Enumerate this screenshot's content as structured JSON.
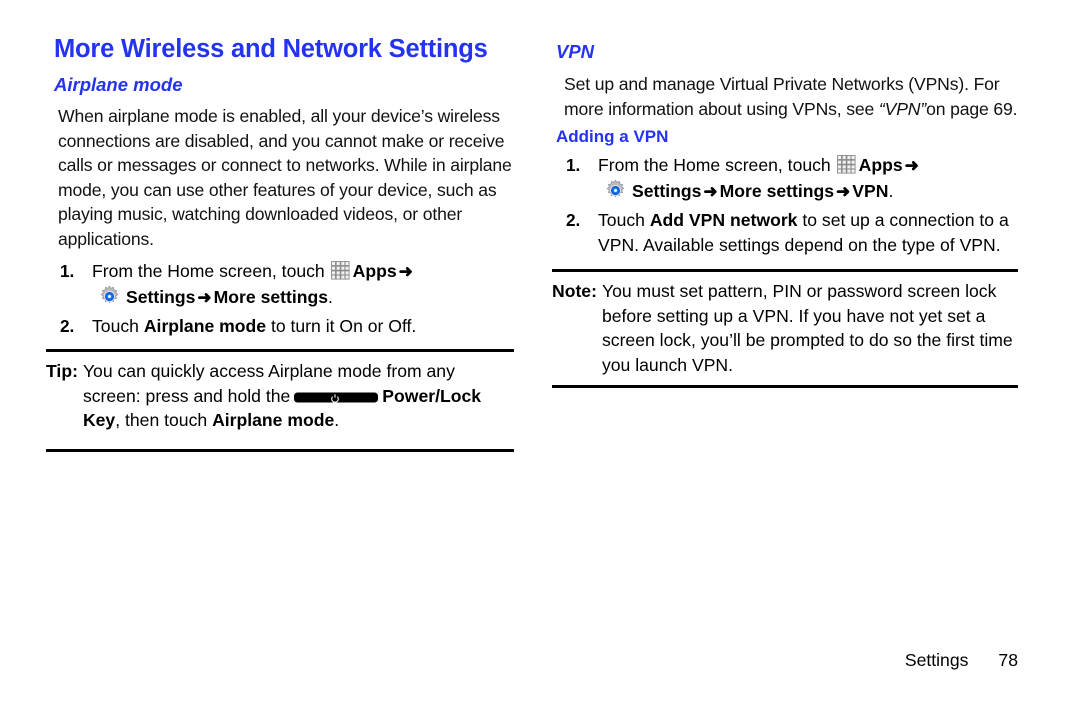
{
  "page": {
    "title": "More Wireless and Network Settings",
    "accent_color": "#2433f0",
    "text_color": "#111111"
  },
  "left_column": {
    "section_heading": "Airplane mode",
    "intro_paragraph": "When airplane mode is enabled, all your device’s wireless connections are disabled, and you cannot make or receive calls or messages or connect to networks. While in airplane mode, you can use other features of your device, such as playing music, watching downloaded videos, or other applications.",
    "steps": [
      {
        "number": "1.",
        "lead": "From the Home screen, touch",
        "apps_label": "Apps",
        "arrow1": "➜",
        "settings_label": "Settings",
        "arrow2": "➜",
        "more_settings_label": "More settings",
        "period": "."
      },
      {
        "number": "2.",
        "text_before": "Touch",
        "bold_term": "Airplane mode",
        "text_after": "to turn it On or Off."
      }
    ],
    "tip": {
      "label": "Tip:",
      "line1": "You can quickly access Airplane mode from any screen:",
      "line2_before": "press and hold the",
      "power_key_label": "Power/Lock Key",
      "line2_after": ", then touch",
      "line3_bold": "Airplane mode",
      "line3_period": "."
    }
  },
  "right_column": {
    "section_heading": "VPN",
    "intro_before": "Set up and manage Virtual Private Networks (VPNs). For more information about using VPNs, see",
    "intro_quoted_italic": "“VPN”",
    "intro_after": "on page 69.",
    "sub_heading": "Adding a VPN",
    "steps": [
      {
        "number": "1.",
        "lead": "From the Home screen, touch",
        "apps_label": "Apps",
        "arrow1": "➜",
        "settings_label": "Settings",
        "arrow2": "➜",
        "more_settings_label": "More settings",
        "arrow3": "➜",
        "vpn_label": "VPN",
        "period": "."
      },
      {
        "number": "2.",
        "text_before": "Touch",
        "bold_term": "Add VPN network",
        "text_after": "to set up a connection to a VPN. Available settings depend on the type of VPN."
      }
    ],
    "note": {
      "label": "Note:",
      "text": "You must set pattern, PIN or password screen lock before setting up a VPN. If you have not yet set a screen lock, you’ll be prompted to do so the first time you launch VPN."
    }
  },
  "footer": {
    "section_name": "Settings",
    "page_number": "78"
  },
  "icons": {
    "apps": "apps-grid-icon",
    "settings": "settings-gear-icon",
    "power": "power-lock-key-icon"
  }
}
